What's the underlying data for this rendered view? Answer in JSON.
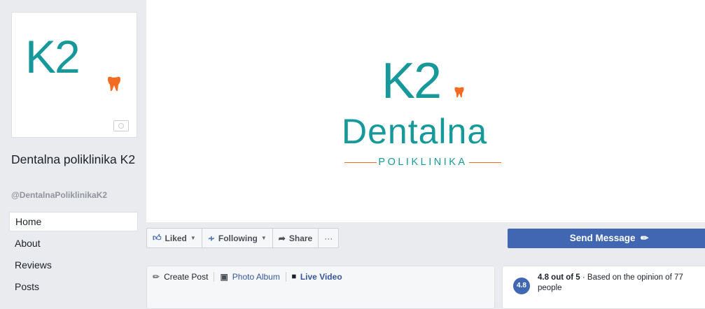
{
  "page": {
    "name": "Dentalna poliklinika K2",
    "handle": "@DentalnaPoliklinikaK2"
  },
  "logo": {
    "k2": "K2",
    "brand": "Dentalna",
    "sub": "POLIKLINIKA",
    "brand_color": "#17999b",
    "accent_color": "#f36b21"
  },
  "nav": {
    "items": [
      {
        "label": "Home",
        "active": true
      },
      {
        "label": "About"
      },
      {
        "label": "Reviews"
      },
      {
        "label": "Posts"
      }
    ]
  },
  "actions": {
    "liked": "Liked",
    "following": "Following",
    "share": "Share",
    "more": "···",
    "send_message": "Send Message"
  },
  "composer": {
    "create_post": "Create Post",
    "photo_album": "Photo Album",
    "live_video": "Live Video"
  },
  "rating": {
    "badge": "4.8",
    "score_text": "4.8 out of 5",
    "detail": " · Based on the opinion of 77 people"
  },
  "colors": {
    "fb_blue": "#4267b2",
    "link_blue": "#365899",
    "background": "#e9ebee"
  }
}
